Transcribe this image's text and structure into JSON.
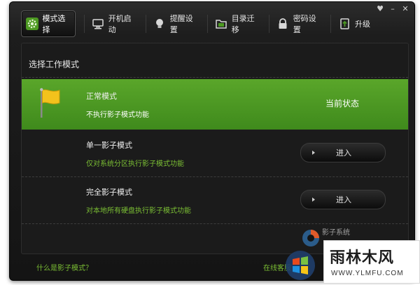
{
  "window": {
    "controls": [
      "♥",
      "–",
      "✕"
    ]
  },
  "tabs": [
    {
      "label": "模式选择",
      "icon": "gear-icon",
      "active": true
    },
    {
      "label": "开机启动",
      "icon": "monitor-icon",
      "active": false
    },
    {
      "label": "提醒设置",
      "icon": "bulb-icon",
      "active": false
    },
    {
      "label": "目录迁移",
      "icon": "folder-icon",
      "active": false
    },
    {
      "label": "密码设置",
      "icon": "lock-icon",
      "active": false
    },
    {
      "label": "升级",
      "icon": "upgrade-icon",
      "active": false
    }
  ],
  "panel": {
    "title": "选择工作模式",
    "modes": [
      {
        "title": "正常模式",
        "desc": "不执行影子模式功能",
        "status": "当前状态",
        "selected": true
      },
      {
        "title": "单一影子模式",
        "desc": "仅对系统分区执行影子模式功能",
        "button": "进入",
        "selected": false
      },
      {
        "title": "完全影子模式",
        "desc": "对本地所有硬盘执行影子模式功能",
        "button": "进入",
        "selected": false
      }
    ]
  },
  "footer": {
    "help_link": "什么是影子模式？",
    "service_link": "在线客服"
  },
  "brand": {
    "name": "影子系统"
  },
  "watermark": {
    "title": "雨林木风",
    "url": "WWW.YLMFU.COM"
  },
  "colors": {
    "accent_green": "#4f9a24",
    "link_green": "#7bbf34",
    "window_bg": "#141414"
  }
}
